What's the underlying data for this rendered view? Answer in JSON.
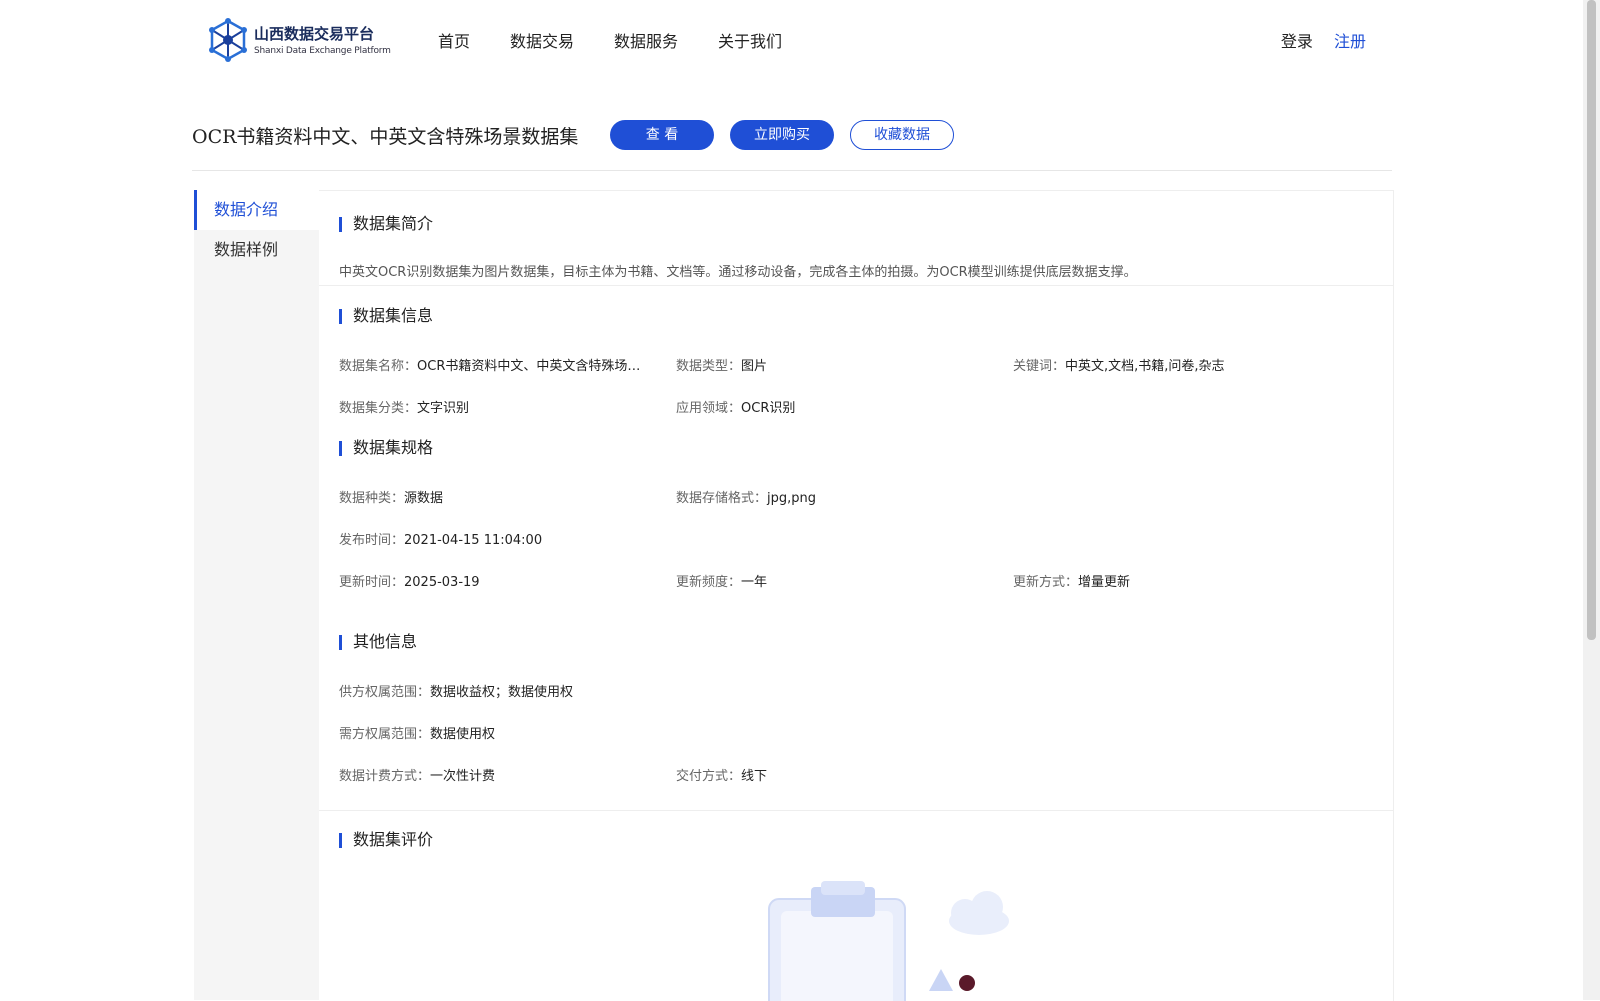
{
  "header": {
    "logo_cn": "山西数据交易平台",
    "logo_en": "Shanxi Data Exchange Platform",
    "nav": [
      "首页",
      "数据交易",
      "数据服务",
      "关于我们"
    ],
    "login": "登录",
    "register": "注册"
  },
  "product": {
    "title": "OCR书籍资料中文、中英文含特殊场景数据集",
    "btn_view": "查 看",
    "btn_buy": "立即购买",
    "btn_fav": "收藏数据"
  },
  "sidebar": {
    "items": [
      "数据介绍",
      "数据样例"
    ]
  },
  "intro": {
    "title": "数据集简介",
    "text": "中英文OCR识别数据集为图片数据集，目标主体为书籍、文档等。通过移动设备，完成各主体的拍摄。为OCR模型训练提供底层数据支撑。"
  },
  "info": {
    "title": "数据集信息",
    "name_k": "数据集名称：",
    "name_v": "OCR书籍资料中文、中英文含特殊场景数据集",
    "type_k": "数据类型：",
    "type_v": "图片",
    "kw_k": "关键词：",
    "kw_v": "中英文,文档,书籍,问卷,杂志",
    "cat_k": "数据集分类：",
    "cat_v": "文字识别",
    "domain_k": "应用领域：",
    "domain_v": "OCR识别"
  },
  "spec": {
    "title": "数据集规格",
    "kind_k": "数据种类：",
    "kind_v": "源数据",
    "fmt_k": "数据存储格式：",
    "fmt_v": "jpg,png",
    "pub_k": "发布时间：",
    "pub_v": "2021-04-15 11:04:00",
    "upd_k": "更新时间：",
    "upd_v": "2025-03-19",
    "freq_k": "更新频度：",
    "freq_v": "一年",
    "mode_k": "更新方式：",
    "mode_v": "增量更新"
  },
  "other": {
    "title": "其他信息",
    "supply_k": "供方权属范围：",
    "supply_v": "数据收益权；数据使用权",
    "demand_k": "需方权属范围：",
    "demand_v": "数据使用权",
    "bill_k": "数据计费方式：",
    "bill_v": "一次性计费",
    "deliver_k": "交付方式：",
    "deliver_v": "线下"
  },
  "review": {
    "title": "数据集评价"
  },
  "colors": {
    "accent": "#1f4fd6",
    "sidebar_bg": "#f5f5f5"
  },
  "icons": {
    "logo": "hexagon-network-logo",
    "empty": "empty-clipboard-illustration"
  }
}
